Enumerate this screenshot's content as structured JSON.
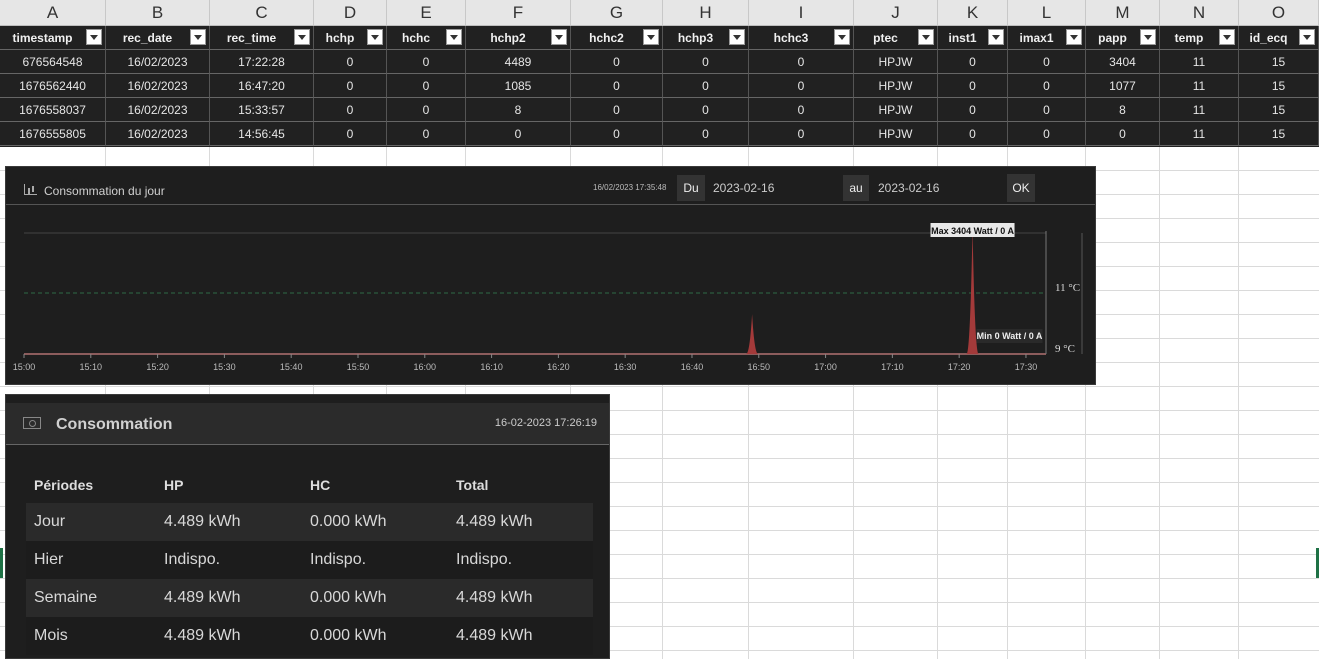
{
  "sheet": {
    "columns": [
      "A",
      "B",
      "C",
      "D",
      "E",
      "F",
      "G",
      "H",
      "I",
      "J",
      "K",
      "L",
      "M",
      "N",
      "O"
    ],
    "headers": [
      "timestamp",
      "rec_date",
      "rec_time",
      "hchp",
      "hchc",
      "hchp2",
      "hchc2",
      "hchp3",
      "hchc3",
      "ptec",
      "inst1",
      "imax1",
      "papp",
      "temp",
      "id_ecq"
    ],
    "rows": [
      [
        "676564548",
        "16/02/2023",
        "17:22:28",
        "0",
        "0",
        "4489",
        "0",
        "0",
        "0",
        "HPJW",
        "0",
        "0",
        "3404",
        "11",
        "15"
      ],
      [
        "1676562440",
        "16/02/2023",
        "16:47:20",
        "0",
        "0",
        "1085",
        "0",
        "0",
        "0",
        "HPJW",
        "0",
        "0",
        "1077",
        "11",
        "15"
      ],
      [
        "1676558037",
        "16/02/2023",
        "15:33:57",
        "0",
        "0",
        "8",
        "0",
        "0",
        "0",
        "HPJW",
        "0",
        "0",
        "8",
        "11",
        "15"
      ],
      [
        "1676555805",
        "16/02/2023",
        "14:56:45",
        "0",
        "0",
        "0",
        "0",
        "0",
        "0",
        "HPJW",
        "0",
        "0",
        "0",
        "11",
        "15"
      ]
    ]
  },
  "chart_panel": {
    "title": "Consommation du jour",
    "timestamp": "16/02/2023 17:35:48",
    "du_label": "Du",
    "au_label": "au",
    "date_from": "2023-02-16",
    "date_to": "2023-02-16",
    "ok_label": "OK"
  },
  "chart_data": {
    "type": "area",
    "x_ticks": [
      "15:00",
      "15:10",
      "15:20",
      "15:30",
      "15:40",
      "15:50",
      "16:00",
      "16:10",
      "16:20",
      "16:30",
      "16:40",
      "16:50",
      "17:00",
      "17:10",
      "17:20",
      "17:30"
    ],
    "x_range": [
      "15:00",
      "17:30"
    ],
    "series": [
      {
        "peaks": [
          {
            "time": "16:49",
            "value": 1077
          },
          {
            "time": "17:22",
            "value": 3404
          }
        ]
      }
    ],
    "y_range": [
      0,
      3700
    ],
    "temperature_line_celsius": 11,
    "temperature_axis_ticks": [
      "11 °C",
      "9 °C"
    ],
    "max_annotation": "Max 3404 Watt / 0 A",
    "min_annotation": "Min 0 Watt / 0 A",
    "colors": {
      "area": "#a33a3a",
      "temperature_line": "#2e6b45",
      "grid": "#444444"
    }
  },
  "conso_panel": {
    "title": "Consommation",
    "timestamp": "16-02-2023 17:26:19",
    "headers": [
      "Périodes",
      "HP",
      "HC",
      "Total"
    ],
    "rows": [
      [
        "Jour",
        "4.489 kWh",
        "0.000 kWh",
        "4.489 kWh"
      ],
      [
        "Hier",
        "Indispo.",
        "Indispo.",
        "Indispo."
      ],
      [
        "Semaine",
        "4.489 kWh",
        "0.000 kWh",
        "4.489 kWh"
      ],
      [
        "Mois",
        "4.489 kWh",
        "0.000 kWh",
        "4.489 kWh"
      ]
    ]
  }
}
